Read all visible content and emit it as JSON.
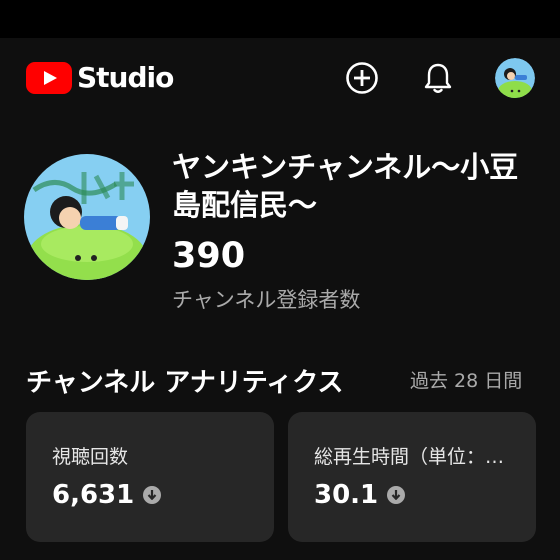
{
  "app": {
    "logo_text": "Studio",
    "icons": [
      "youtube-logo-icon",
      "create-icon",
      "notifications-bell-icon"
    ],
    "brand_color": "#ff0000",
    "background_color": "#0f0f0f"
  },
  "channel": {
    "name": "ヤンキンチャンネル〜小豆島配信民〜",
    "subscriber_count": "390",
    "subscriber_label": "チャンネル登録者数"
  },
  "analytics": {
    "title": "チャンネル アナリティクス",
    "period": "過去 28 日間",
    "cards": [
      {
        "label": "視聴回数",
        "value": "6,631",
        "trend_icon": "down-arrow-icon"
      },
      {
        "label": "総再生時間（単位：時間）",
        "value": "30.1",
        "trend_icon": "down-arrow-icon"
      }
    ],
    "card_color": "#272727"
  }
}
